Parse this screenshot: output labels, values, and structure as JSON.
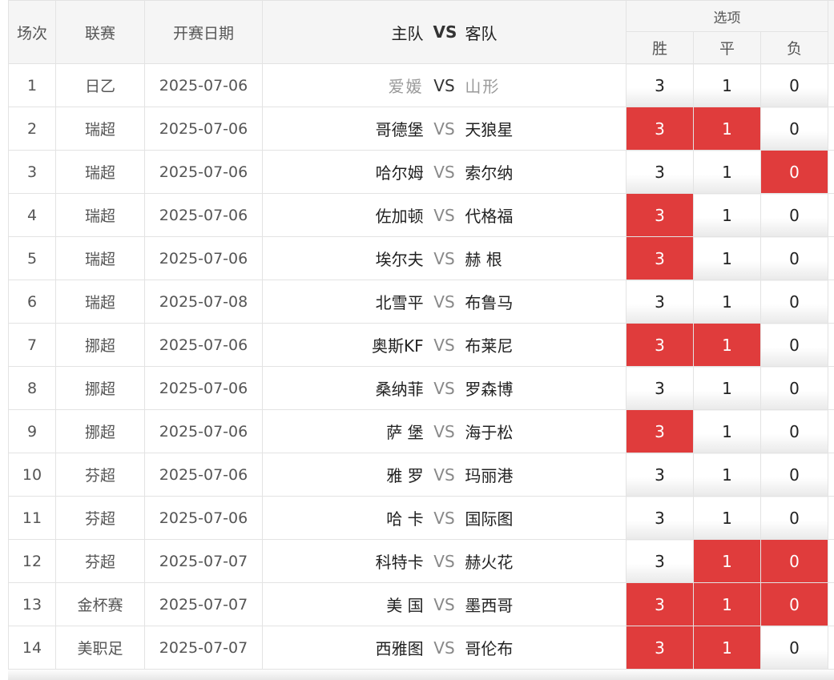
{
  "header": {
    "col_num": "场次",
    "col_league": "联赛",
    "col_date": "开赛日期",
    "col_home": "主队",
    "col_vs": "VS",
    "col_away": "客队",
    "col_options": "选项",
    "opt_win": "胜",
    "opt_draw": "平",
    "opt_lose": "负"
  },
  "colors": {
    "selected": "#e03c3c",
    "header_bg": "#f5f5f5"
  },
  "rows": [
    {
      "num": "1",
      "league": "日乙",
      "date": "2025-07-06",
      "home": "爱媛",
      "vs": "VS",
      "away": "山形",
      "w": "3",
      "d": "1",
      "l": "0",
      "sel": [
        false,
        false,
        false
      ]
    },
    {
      "num": "2",
      "league": "瑞超",
      "date": "2025-07-06",
      "home": "哥德堡",
      "vs": "VS",
      "away": "天狼星",
      "w": "3",
      "d": "1",
      "l": "0",
      "sel": [
        true,
        true,
        false
      ]
    },
    {
      "num": "3",
      "league": "瑞超",
      "date": "2025-07-06",
      "home": "哈尔姆",
      "vs": "VS",
      "away": "索尔纳",
      "w": "3",
      "d": "1",
      "l": "0",
      "sel": [
        false,
        false,
        true
      ]
    },
    {
      "num": "4",
      "league": "瑞超",
      "date": "2025-07-06",
      "home": "佐加顿",
      "vs": "VS",
      "away": "代格福",
      "w": "3",
      "d": "1",
      "l": "0",
      "sel": [
        true,
        false,
        false
      ]
    },
    {
      "num": "5",
      "league": "瑞超",
      "date": "2025-07-06",
      "home": "埃尔夫",
      "vs": "VS",
      "away": "赫 根",
      "w": "3",
      "d": "1",
      "l": "0",
      "sel": [
        true,
        false,
        false
      ]
    },
    {
      "num": "6",
      "league": "瑞超",
      "date": "2025-07-08",
      "home": "北雪平",
      "vs": "VS",
      "away": "布鲁马",
      "w": "3",
      "d": "1",
      "l": "0",
      "sel": [
        false,
        false,
        false
      ]
    },
    {
      "num": "7",
      "league": "挪超",
      "date": "2025-07-06",
      "home": "奥斯KF",
      "vs": "VS",
      "away": "布莱尼",
      "w": "3",
      "d": "1",
      "l": "0",
      "sel": [
        true,
        true,
        false
      ]
    },
    {
      "num": "8",
      "league": "挪超",
      "date": "2025-07-06",
      "home": "桑纳菲",
      "vs": "VS",
      "away": "罗森博",
      "w": "3",
      "d": "1",
      "l": "0",
      "sel": [
        false,
        false,
        false
      ]
    },
    {
      "num": "9",
      "league": "挪超",
      "date": "2025-07-06",
      "home": "萨 堡",
      "vs": "VS",
      "away": "海于松",
      "w": "3",
      "d": "1",
      "l": "0",
      "sel": [
        true,
        false,
        false
      ]
    },
    {
      "num": "10",
      "league": "芬超",
      "date": "2025-07-06",
      "home": "雅 罗",
      "vs": "VS",
      "away": "玛丽港",
      "w": "3",
      "d": "1",
      "l": "0",
      "sel": [
        false,
        false,
        false
      ]
    },
    {
      "num": "11",
      "league": "芬超",
      "date": "2025-07-06",
      "home": "哈 卡",
      "vs": "VS",
      "away": "国际图",
      "w": "3",
      "d": "1",
      "l": "0",
      "sel": [
        false,
        false,
        false
      ]
    },
    {
      "num": "12",
      "league": "芬超",
      "date": "2025-07-07",
      "home": "科特卡",
      "vs": "VS",
      "away": "赫火花",
      "w": "3",
      "d": "1",
      "l": "0",
      "sel": [
        false,
        true,
        true
      ]
    },
    {
      "num": "13",
      "league": "金杯赛",
      "date": "2025-07-07",
      "home": "美 国",
      "vs": "VS",
      "away": "墨西哥",
      "w": "3",
      "d": "1",
      "l": "0",
      "sel": [
        true,
        true,
        true
      ]
    },
    {
      "num": "14",
      "league": "美职足",
      "date": "2025-07-07",
      "home": "西雅图",
      "vs": "VS",
      "away": "哥伦布",
      "w": "3",
      "d": "1",
      "l": "0",
      "sel": [
        true,
        true,
        false
      ]
    }
  ]
}
